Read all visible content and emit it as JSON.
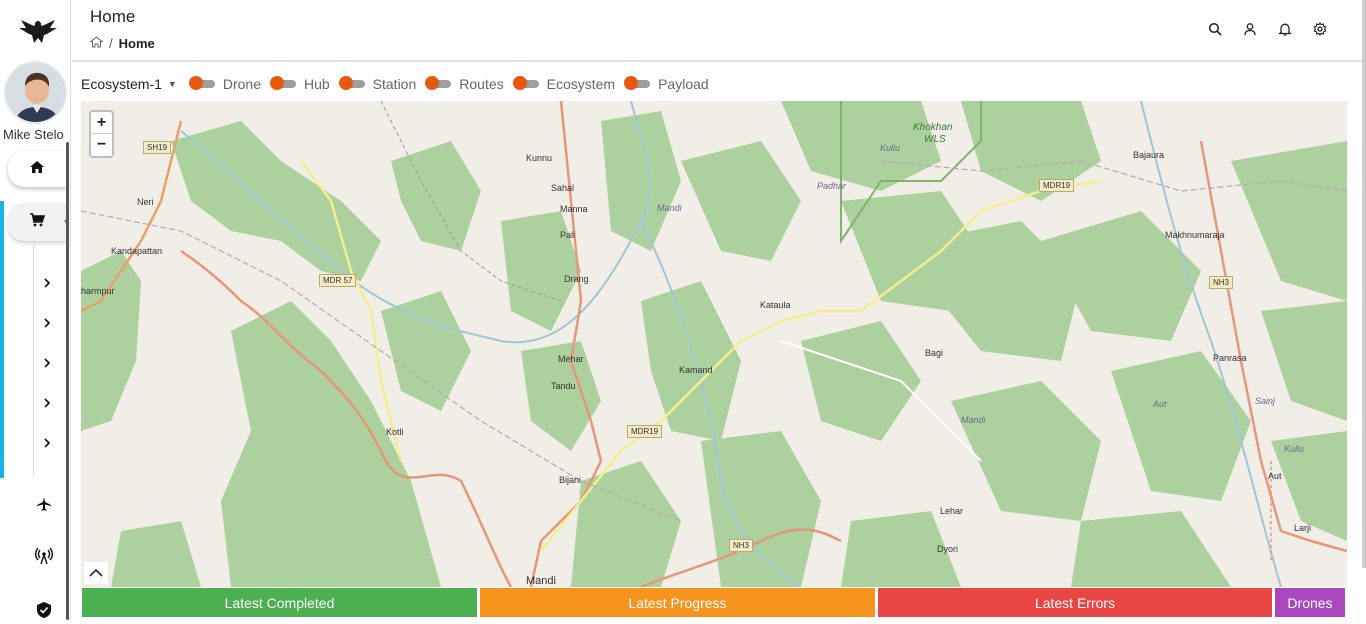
{
  "user": {
    "name": "Mike Stelo"
  },
  "header": {
    "title": "Home",
    "breadcrumb_current": "Home",
    "breadcrumb_separator": "/"
  },
  "toolbar": {
    "ecosystem_value": "Ecosystem-1",
    "toggles": [
      {
        "label": "Drone"
      },
      {
        "label": "Hub"
      },
      {
        "label": "Station"
      },
      {
        "label": "Routes"
      },
      {
        "label": "Ecosystem"
      },
      {
        "label": "Payload"
      }
    ]
  },
  "map": {
    "zoom_in": "+",
    "zoom_out": "−",
    "labels": [
      "Kunnu",
      "Sahal",
      "Manna",
      "Pali",
      "Drang",
      "Mehar",
      "Tandu",
      "Bijani",
      "Mandi",
      "Kamand",
      "Kataula",
      "Bagi",
      "Lehar",
      "Dyori",
      "Makhnumaraja",
      "Panrasa",
      "Bajaura",
      "Aut",
      "Larji",
      "Neri",
      "Kandapattan",
      "harmpur",
      "Kotli",
      "Padhar",
      "Mandi",
      "Kullu",
      "Aut",
      "Sainj",
      "Kullu",
      "Mandi"
    ],
    "shields": [
      "SH19",
      "MDR 57",
      "MDR19",
      "MDR19",
      "NH3",
      "NH3"
    ],
    "wls": [
      "Khokhan",
      "WLS"
    ]
  },
  "status_bar": {
    "completed": "Latest Completed",
    "progress": "Latest Progress",
    "errors": "Latest Errors",
    "drones": "Drones"
  },
  "colors": {
    "completed": "#4caf50",
    "progress": "#f7941d",
    "errors": "#e84545",
    "drones": "#ab47bc",
    "toggle_knob": "#e65a10",
    "sidebar_accent": "#1ab3e6"
  }
}
